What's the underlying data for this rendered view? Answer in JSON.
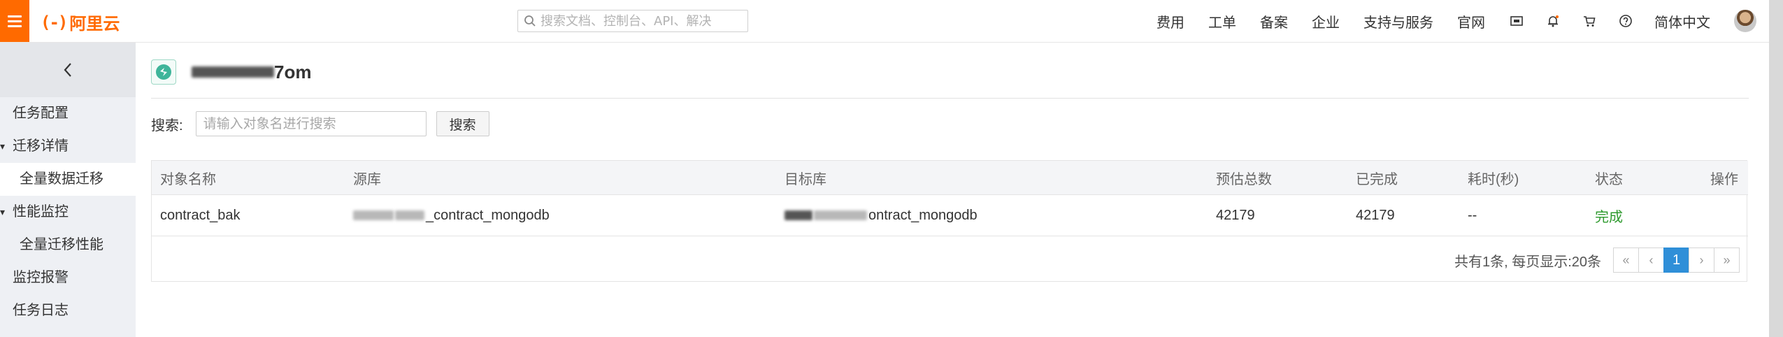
{
  "topbar": {
    "logo_text": "阿里云",
    "logo_mark": "(-)",
    "search_placeholder": "搜索文档、控制台、API、解决",
    "nav_items": [
      "费用",
      "工单",
      "备案",
      "企业",
      "支持与服务",
      "官网"
    ],
    "language": "简体中文",
    "icons": [
      "screen-icon",
      "bell-icon",
      "cart-icon",
      "help-icon"
    ]
  },
  "sidebar": {
    "items": [
      {
        "label": "任务配置"
      },
      {
        "label": "迁移详情",
        "expanded": true
      },
      {
        "label": "全量数据迁移",
        "active": true
      },
      {
        "label": "性能监控",
        "expanded": true
      },
      {
        "label": "全量迁移性能"
      },
      {
        "label": "监控报警"
      },
      {
        "label": "任务日志"
      }
    ]
  },
  "main": {
    "title_suffix": "7om",
    "search_label": "搜索:",
    "search_placeholder": "请输入对象名进行搜索",
    "search_button": "搜索",
    "table": {
      "headers": [
        "对象名称",
        "源库",
        "目标库",
        "预估总数",
        "已完成",
        "耗时(秒)",
        "状态",
        "操作"
      ],
      "rows": [
        {
          "name": "contract_bak",
          "source_suffix": "_contract_mongodb",
          "target_suffix": "ontract_mongodb",
          "estimated_total": "42179",
          "completed": "42179",
          "elapsed": "--",
          "status": "完成",
          "action": ""
        }
      ]
    },
    "pager": {
      "info": "共有1条,  每页显示:20条",
      "first": "«",
      "prev": "‹",
      "current": "1",
      "next": "›",
      "last": "»"
    }
  },
  "colors": {
    "brand": "#ff6a00",
    "pager_active": "#2f8fd8",
    "status_ok": "#2e9a2e"
  }
}
